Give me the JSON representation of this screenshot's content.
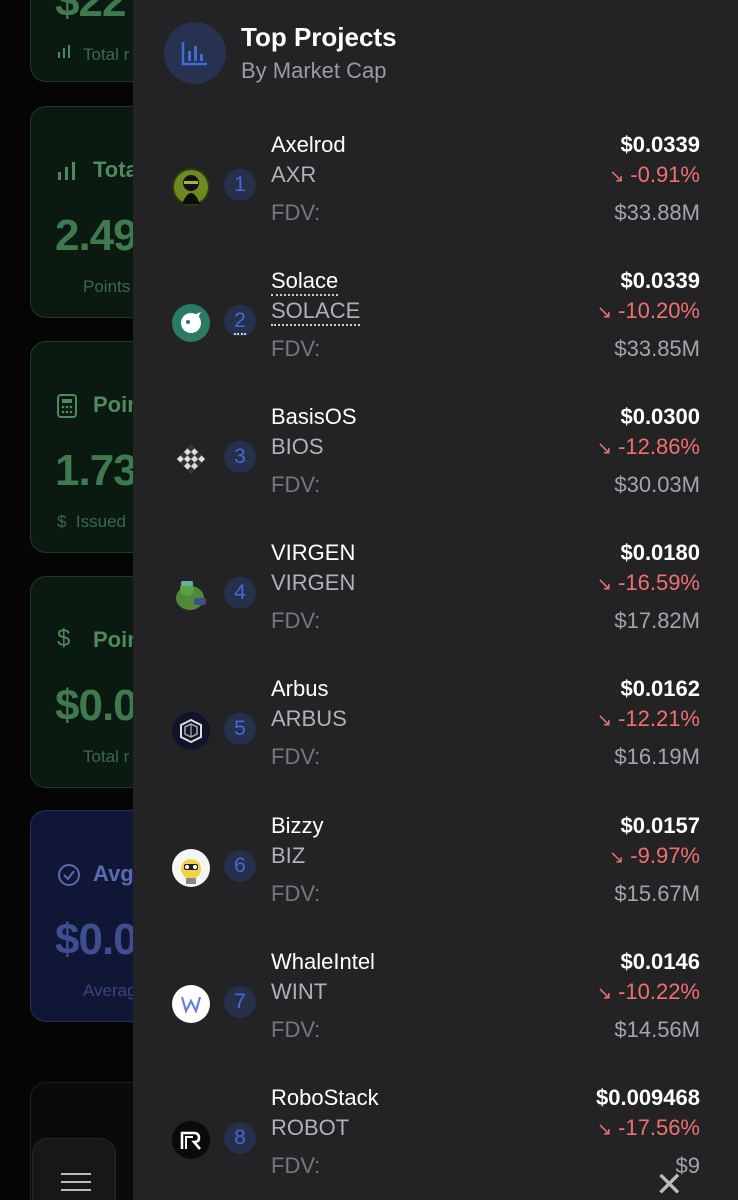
{
  "background": {
    "cards": [
      {
        "icon": "bars-icon",
        "title": "",
        "big": "$22",
        "sub": "Total r"
      },
      {
        "icon": "bars-icon",
        "title": "Tota",
        "big": "2.49",
        "sub": "Points"
      },
      {
        "icon": "calculator-icon",
        "title": "Poin",
        "big": "1.73",
        "sub": "Issued"
      },
      {
        "icon": "dollar-icon",
        "title": "Poin",
        "big": "$0.0",
        "sub": "Total r"
      },
      {
        "icon": "check-circle-icon",
        "title": "Avg",
        "big": "$0.0",
        "sub": "Averag"
      }
    ]
  },
  "drawer": {
    "title": "Top Projects",
    "subtitle": "By Market Cap",
    "fdv_label": "FDV:",
    "colors": {
      "accent": "#3f6cd8",
      "negative": "#f07070",
      "panel": "#232326"
    },
    "projects": [
      {
        "rank": "1",
        "name": "Axelrod",
        "symbol": "AXR",
        "price": "$0.0339",
        "change": "-0.91%",
        "fdv": "$33.88M",
        "avatar": "axelrod-avatar"
      },
      {
        "rank": "2",
        "name": "Solace",
        "symbol": "SOLACE",
        "price": "$0.0339",
        "change": "-10.20%",
        "fdv": "$33.85M",
        "avatar": "solace-avatar"
      },
      {
        "rank": "3",
        "name": "BasisOS",
        "symbol": "BIOS",
        "price": "$0.0300",
        "change": "-12.86%",
        "fdv": "$30.03M",
        "avatar": "basisos-avatar"
      },
      {
        "rank": "4",
        "name": "VIRGEN",
        "symbol": "VIRGEN",
        "price": "$0.0180",
        "change": "-16.59%",
        "fdv": "$17.82M",
        "avatar": "virgen-avatar"
      },
      {
        "rank": "5",
        "name": "Arbus",
        "symbol": "ARBUS",
        "price": "$0.0162",
        "change": "-12.21%",
        "fdv": "$16.19M",
        "avatar": "arbus-avatar"
      },
      {
        "rank": "6",
        "name": "Bizzy",
        "symbol": "BIZ",
        "price": "$0.0157",
        "change": "-9.97%",
        "fdv": "$15.67M",
        "avatar": "bizzy-avatar"
      },
      {
        "rank": "7",
        "name": "WhaleIntel",
        "symbol": "WINT",
        "price": "$0.0146",
        "change": "-10.22%",
        "fdv": "$14.56M",
        "avatar": "whaleintel-avatar"
      },
      {
        "rank": "8",
        "name": "RoboStack",
        "symbol": "ROBOT",
        "price": "$0.009468",
        "change": "-17.56%",
        "fdv": "$9",
        "avatar": "robostack-avatar"
      }
    ]
  }
}
